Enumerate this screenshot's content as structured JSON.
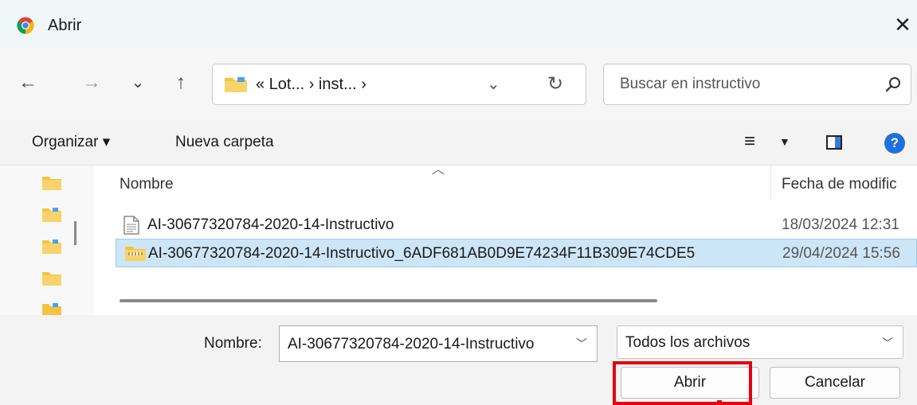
{
  "window": {
    "title": "Abrir",
    "close_glyph": "✕"
  },
  "nav": {
    "back_glyph": "←",
    "forward_glyph": "→",
    "recent_glyph": "⌄",
    "up_glyph": "↑"
  },
  "address": {
    "crumbs": "« Lot... › inst... ›",
    "dropdown_glyph": "⌄",
    "refresh_glyph": "↻"
  },
  "search": {
    "placeholder": "Buscar en instructivo"
  },
  "toolbar": {
    "organize_label": "Organizar ▾",
    "new_folder_label": "Nueva carpeta",
    "view_glyph": "≡",
    "view_drop_glyph": "▼",
    "help_glyph": "?"
  },
  "columns": {
    "name": "Nombre",
    "date": "Fecha de modific"
  },
  "files": [
    {
      "name": "AI-30677320784-2020-14-Instructivo",
      "date": "18/03/2024 12:31",
      "icon": "document-icon",
      "selected": false
    },
    {
      "name": "AI-30677320784-2020-14-Instructivo_6ADF681AB0D9E74234F11B309E74CDE5",
      "date": "29/04/2024 15:56",
      "icon": "zip-folder-icon",
      "selected": true
    }
  ],
  "footer": {
    "name_label": "Nombre:",
    "name_value": "AI-30677320784-2020-14-Instructivo",
    "filetype_value": "Todos los archivos",
    "open_label": "Abrir",
    "cancel_label": "Cancelar"
  },
  "colors": {
    "accent": "#1f6fdc",
    "selection": "#cde6f7",
    "highlight": "#e4000f",
    "folder": "#f5c343"
  }
}
